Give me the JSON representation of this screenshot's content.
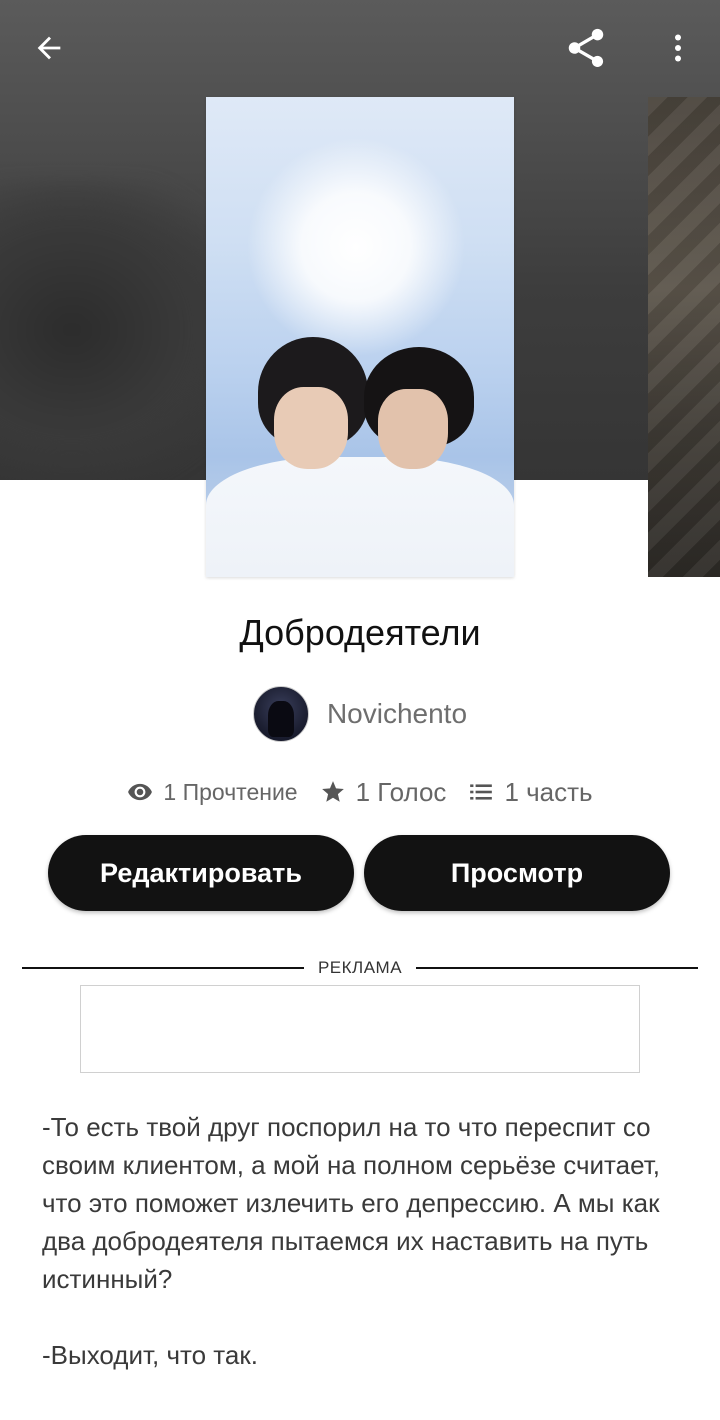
{
  "header": {
    "back_icon": "arrow-left-icon",
    "share_icon": "share-icon",
    "more_icon": "more-vertical-icon"
  },
  "story": {
    "title": "Добродеятели",
    "author": "Novichento",
    "stats": {
      "reads": "1 Прочтение",
      "votes": "1 Голос",
      "parts": "1 часть"
    },
    "icons": {
      "reads": "eye-icon",
      "votes": "star-icon",
      "parts": "list-icon"
    }
  },
  "actions": {
    "edit_label": "Редактировать",
    "view_label": "Просмотр"
  },
  "ad": {
    "label": "РЕКЛАМА"
  },
  "excerpt": {
    "paragraph_1": "-То есть твой друг поспорил на то что переспит со своим клиентом, а мой на полном серьёзе считает, что это поможет излечить его депрессию. А мы как два добродеятеля пытаемся их наставить на путь истинный?",
    "paragraph_2": "-Выходит, что так."
  },
  "colors": {
    "button_bg": "#121212",
    "button_text": "#ffffff",
    "hero_bg": "#4a4a4a",
    "muted_text": "#6e6e6e"
  }
}
